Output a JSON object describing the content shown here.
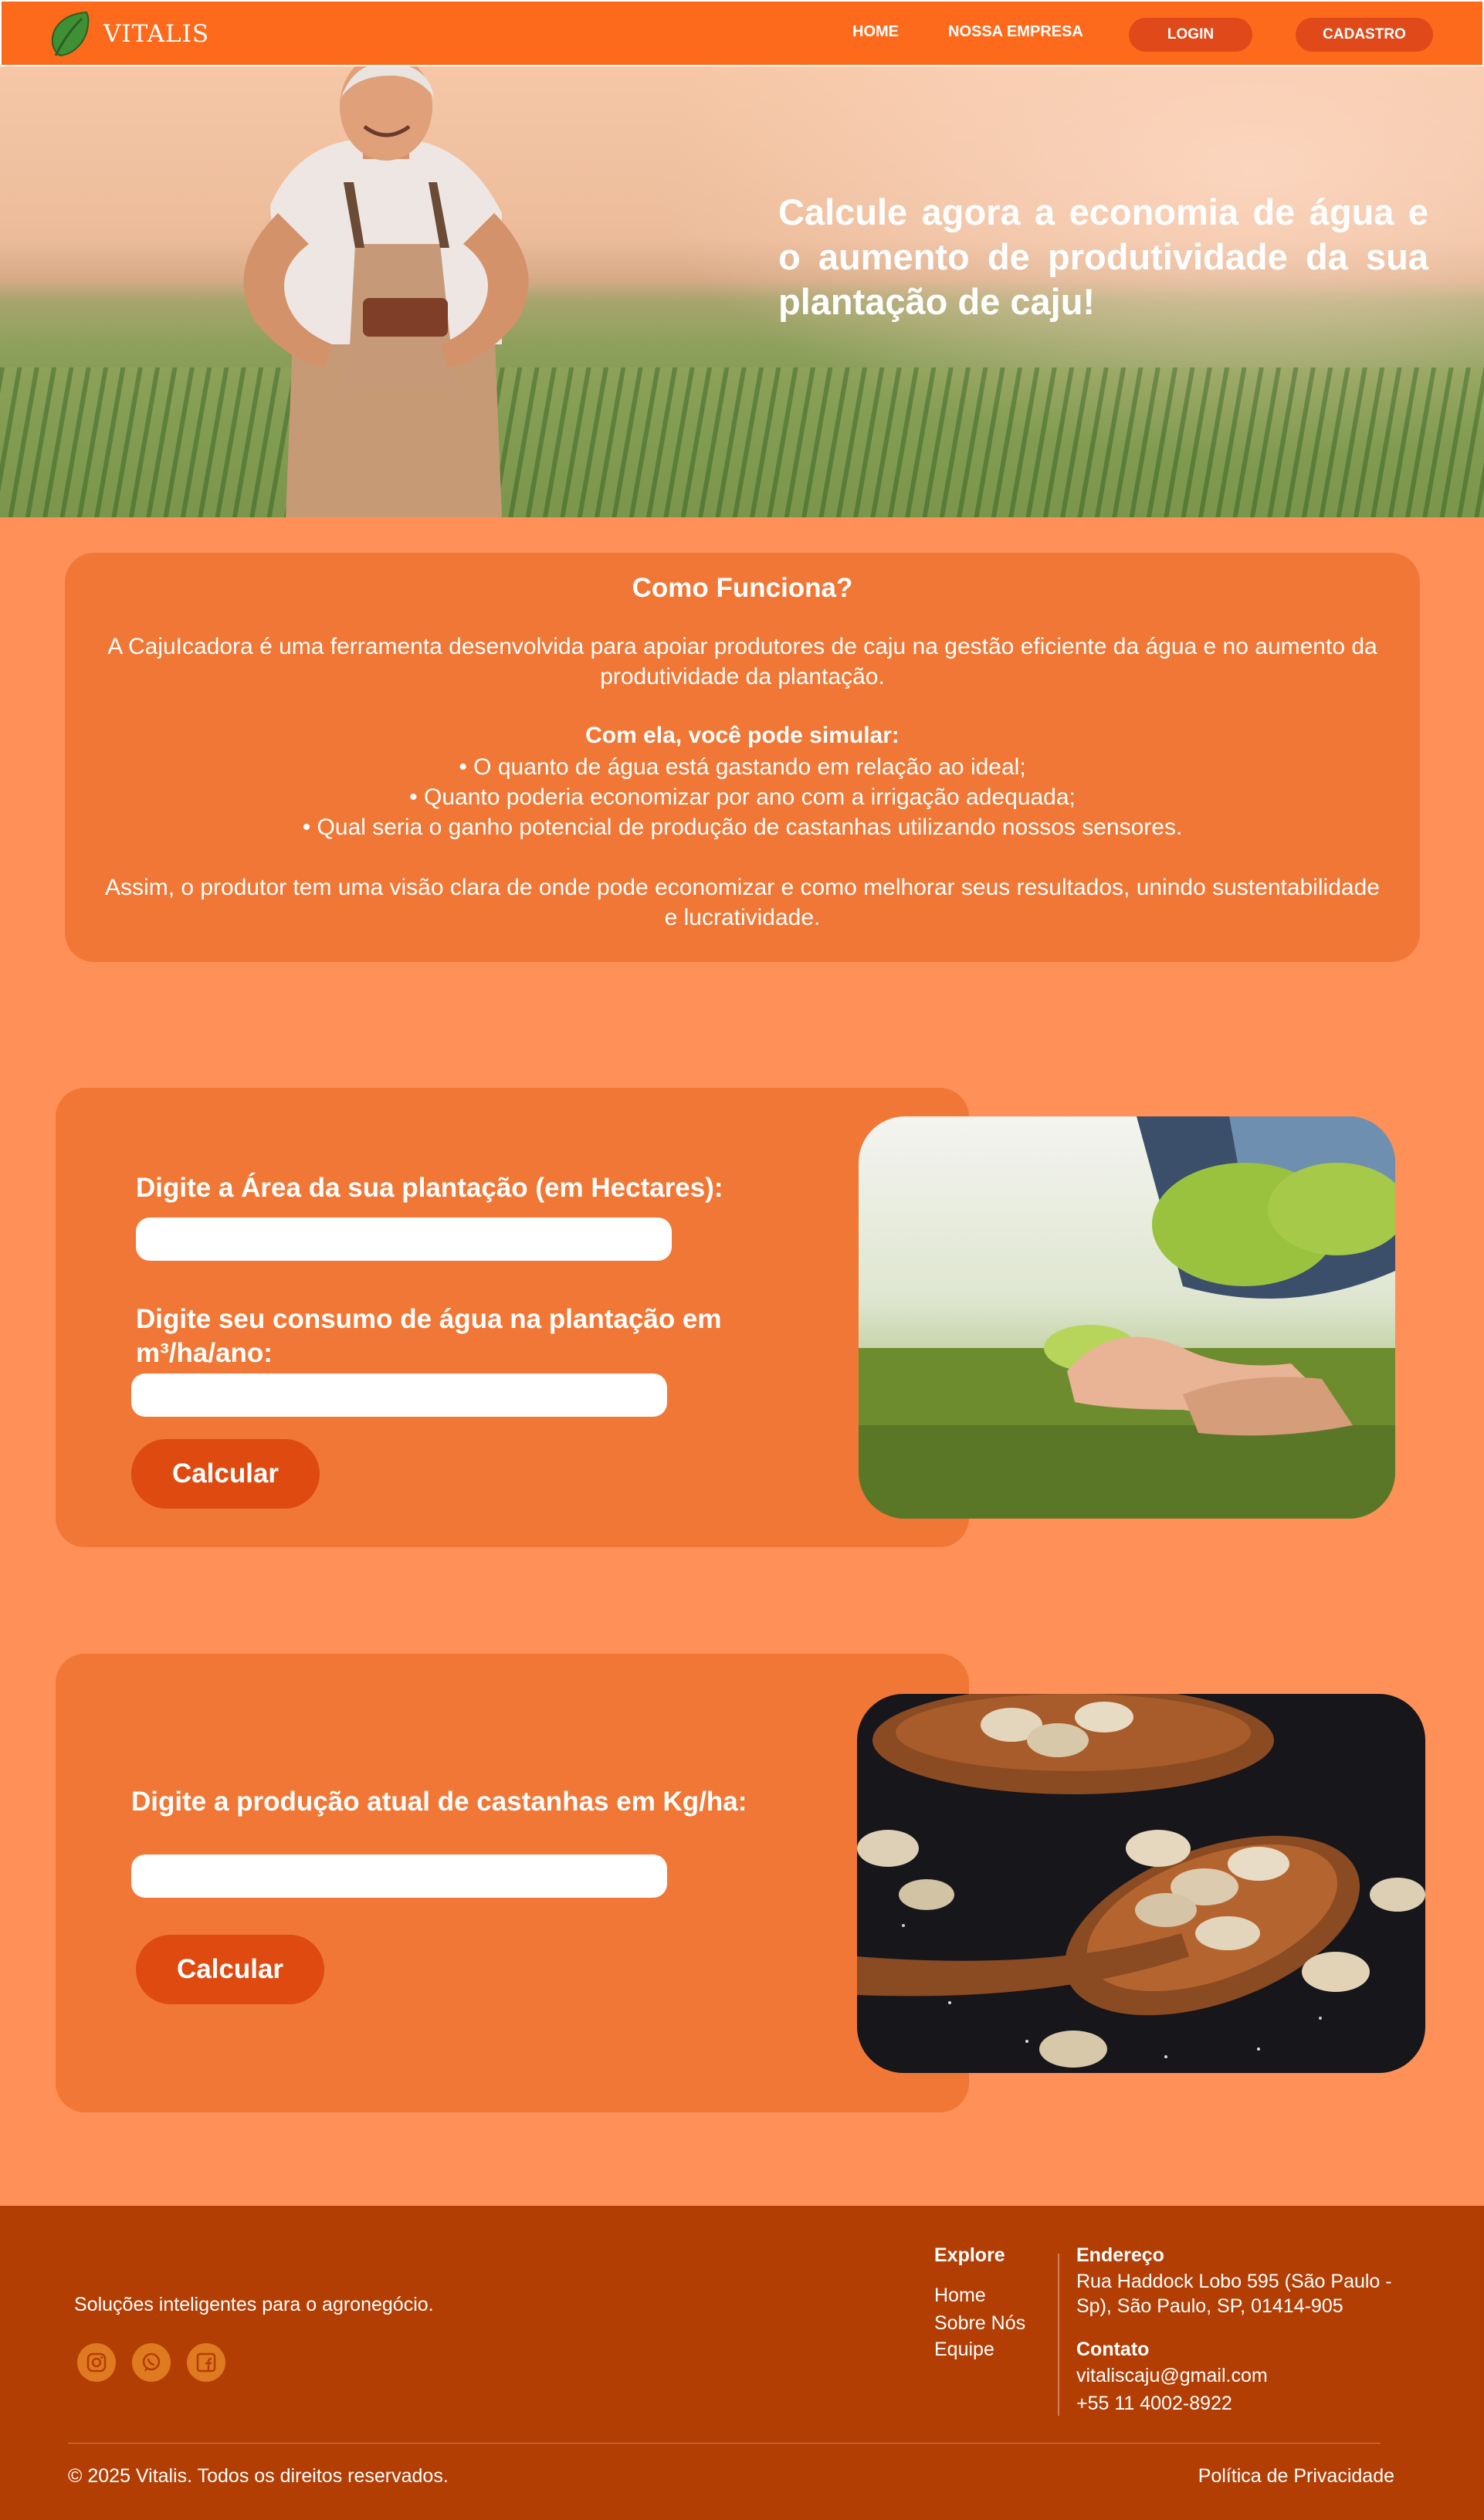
{
  "header": {
    "brand": "VITALIS",
    "nav": {
      "home": "HOME",
      "company": "NOSSA EMPRESA"
    },
    "login": "LOGIN",
    "signup": "CADASTRO"
  },
  "hero": {
    "title": "Calcule agora a economia de água e o aumento de produtividade da sua plantação de caju!"
  },
  "how": {
    "title": "Como Funciona?",
    "intro": "A CajuIcadora é uma ferramenta desenvolvida para apoiar produtores de caju na gestão eficiente da água e no aumento da produtividade da plantação.",
    "subtitle": "Com ela, você pode simular:",
    "items": [
      "O quanto de água está gastando em relação ao ideal;",
      "Quanto poderia economizar por ano com a irrigação adequada;",
      "Qual seria o ganho potencial de produção de castanhas utilizando nossos sensores."
    ],
    "outro": "Assim, o produtor tem uma visão clara de onde pode economizar e como melhorar seus resultados, unindo sustentabilidade e lucratividade."
  },
  "water_form": {
    "area_label": "Digite a Área da sua plantação (em Hectares):",
    "area_value": "",
    "consumption_label": "Digite seu consumo de água na plantação em m³/ha/ano:",
    "consumption_value": "",
    "button": "Calcular"
  },
  "production_form": {
    "label": "Digite a produção atual de castanhas em Kg/ha:",
    "value": "",
    "button": "Calcular"
  },
  "footer": {
    "tagline": "Soluções inteligentes para o agronegócio.",
    "social_icons": [
      "instagram-icon",
      "whatsapp-icon",
      "facebook-icon"
    ],
    "explore": {
      "title": "Explore",
      "links": [
        "Home",
        "Sobre Nós",
        "Equipe"
      ]
    },
    "address": {
      "title": "Endereço",
      "line1": "Rua Haddock Lobo 595 (São Paulo -",
      "line2": "Sp), São Paulo, SP, 01414-905"
    },
    "contact": {
      "title": "Contato",
      "email": "vitaliscaju@gmail.com",
      "phone": "+55 11 4002-8922"
    },
    "copyright": "© 2025 Vitalis. Todos os direitos reservados.",
    "privacy": "Política de Privacidade"
  },
  "colors": {
    "header": "#fd6a1b",
    "page_bg": "#fe9058",
    "card": "#f07735",
    "button": "#de4a10",
    "footer": "#b33e04"
  }
}
